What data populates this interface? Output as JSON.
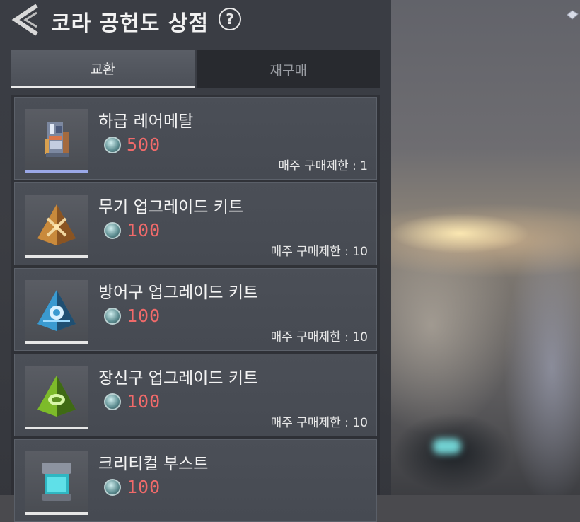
{
  "header": {
    "title": "코라 공헌도 상점",
    "help_symbol": "?"
  },
  "tabs": [
    {
      "label": "교환",
      "active": true
    },
    {
      "label": "재구매",
      "active": false
    }
  ],
  "items": [
    {
      "name": "하급 레어메탈",
      "price": "500",
      "limit": "매주 구매제한 : 1",
      "icon": "rare-metal-icon"
    },
    {
      "name": "무기 업그레이드 키트",
      "price": "100",
      "limit": "매주 구매제한 : 10",
      "icon": "weapon-kit-icon"
    },
    {
      "name": "방어구 업그레이드 키트",
      "price": "100",
      "limit": "매주 구매제한 : 10",
      "icon": "armor-kit-icon"
    },
    {
      "name": "장신구 업그레이드 키트",
      "price": "100",
      "limit": "매주 구매제한 : 10",
      "icon": "accessory-kit-icon"
    },
    {
      "name": "크리티컬 부스트",
      "price": "100",
      "limit": "",
      "icon": "critical-boost-icon"
    }
  ],
  "colors": {
    "price": "#f06a6a",
    "weapon_kit": "#c98a3c",
    "armor_kit": "#3a9ad0",
    "accessory_kit": "#7dbb2a",
    "boost": "#5fe0e8"
  }
}
